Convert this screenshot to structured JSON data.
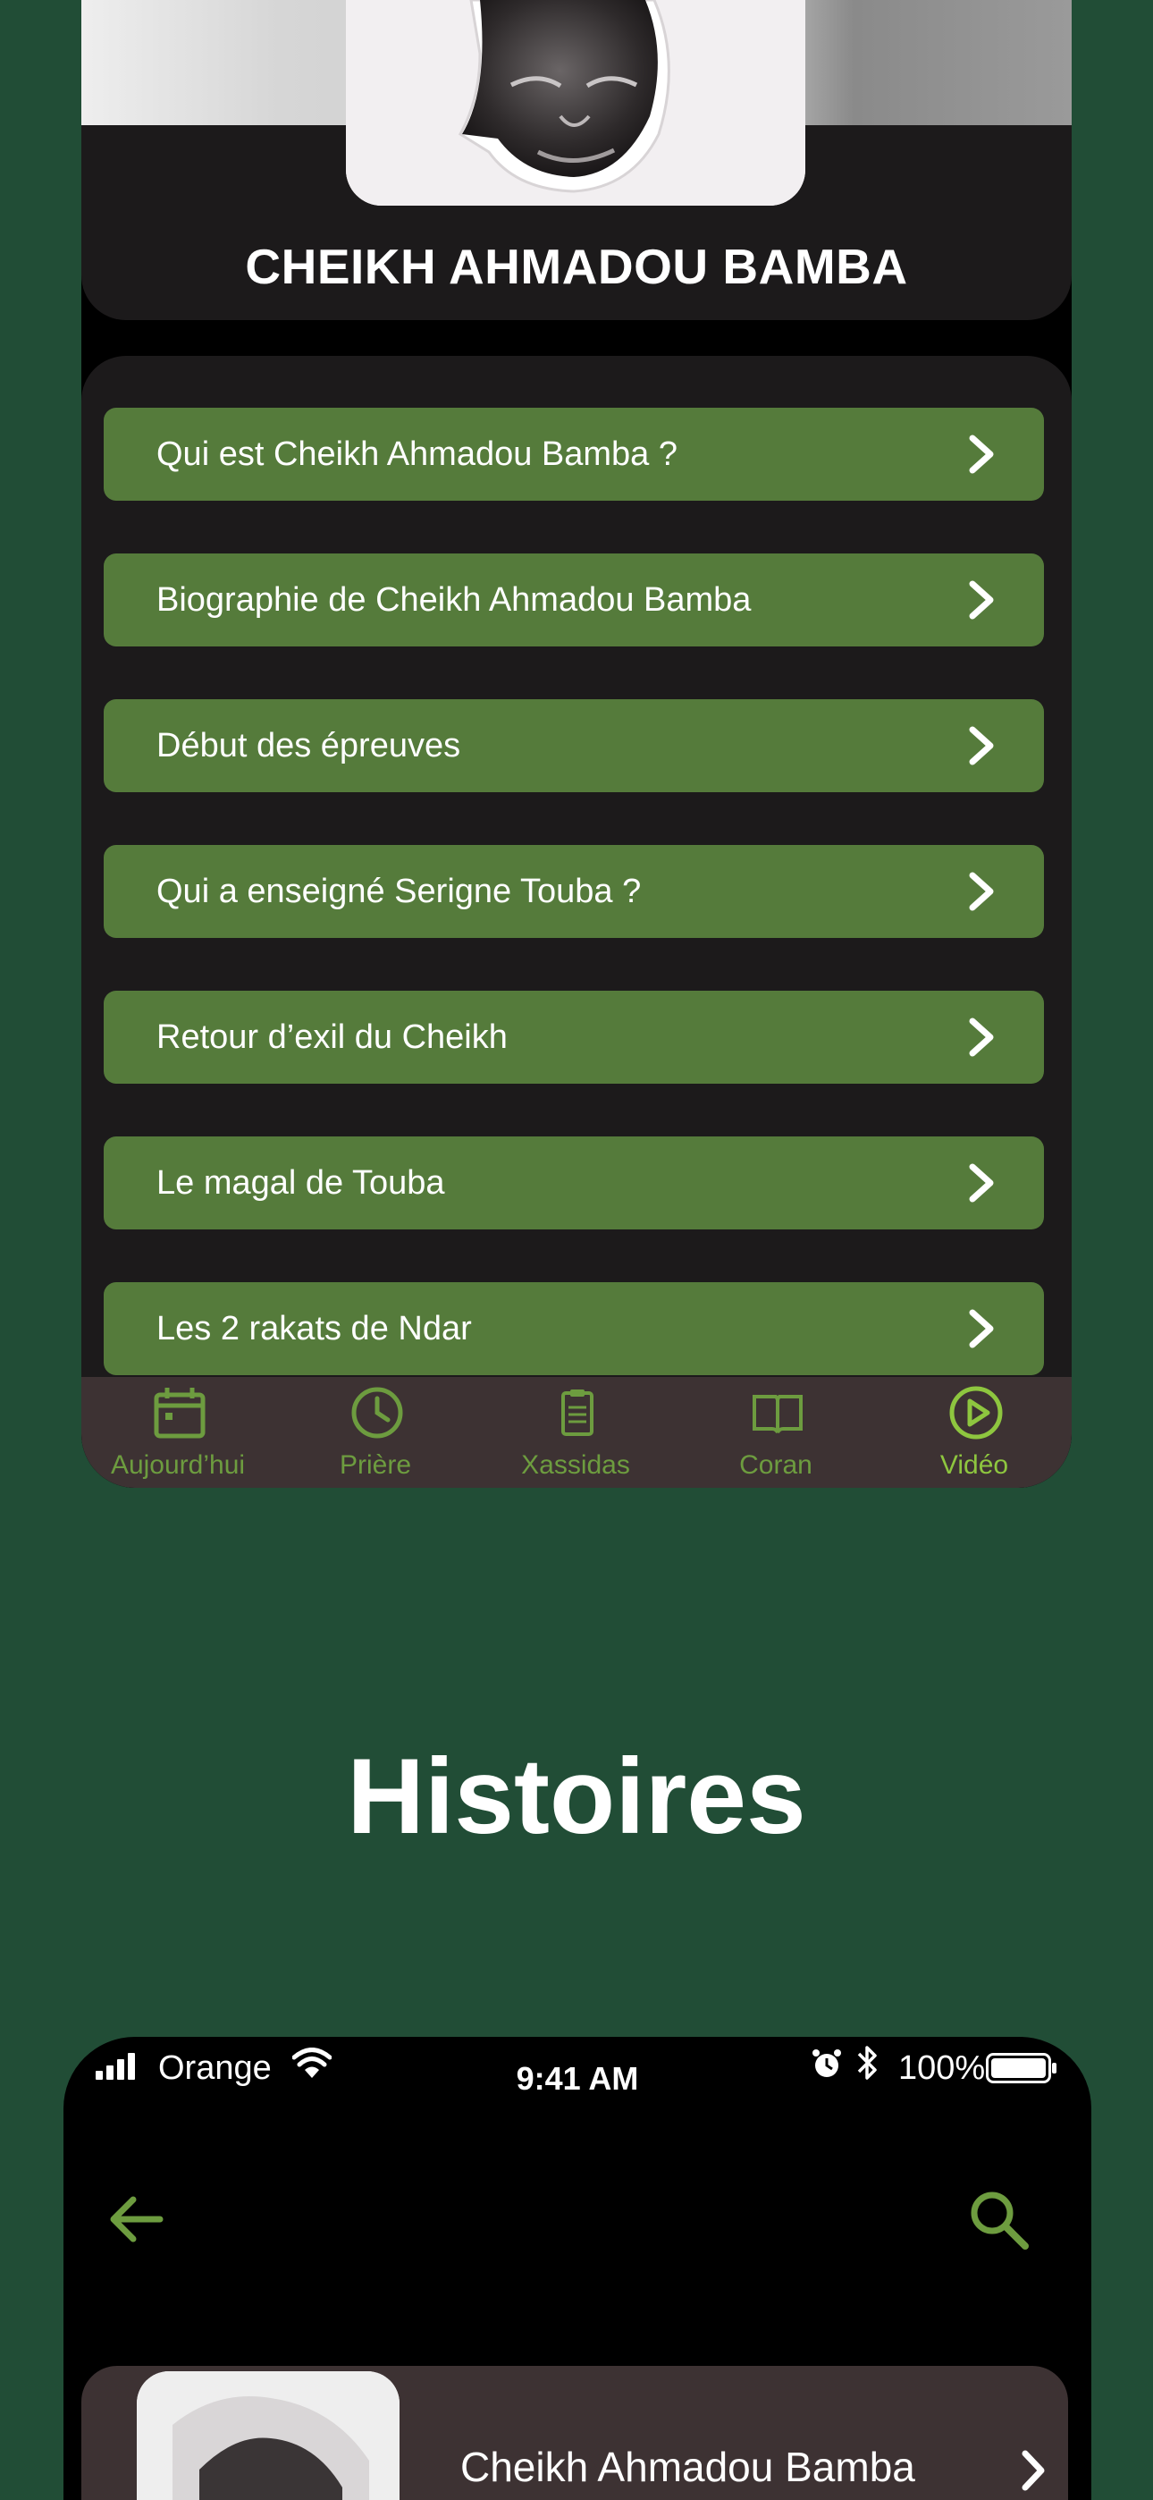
{
  "header": {
    "title": "CHEIKH AHMADOU BAMBA"
  },
  "stories": [
    {
      "label": "Qui est Cheikh Ahmadou Bamba ?"
    },
    {
      "label": "Biographie de Cheikh Ahmadou Bamba"
    },
    {
      "label": "Début des épreuves"
    },
    {
      "label": "Qui a enseigné Serigne Touba ?"
    },
    {
      "label": "Retour d’exil du Cheikh"
    },
    {
      "label": "Le magal de Touba"
    },
    {
      "label": "Les 2 rakats de Ndar"
    }
  ],
  "tabs": [
    {
      "label": "Aujourd’hui",
      "icon": "calendar-icon"
    },
    {
      "label": "Prière",
      "icon": "clock-icon"
    },
    {
      "label": "Xassidas",
      "icon": "clipboard-icon"
    },
    {
      "label": "Coran",
      "icon": "book-icon"
    },
    {
      "label": "Vidéo",
      "icon": "play-circle-icon"
    }
  ],
  "section_heading": "Histoires",
  "status_bar": {
    "carrier": "Orange",
    "time": "9:41 AM",
    "battery": "100%"
  },
  "toolbar": {
    "back_icon": "arrow-left-icon",
    "search_icon": "search-icon"
  },
  "card": {
    "title": "Cheikh Ahmadou Bamba"
  },
  "colors": {
    "background": "#214d36",
    "accent": "#557b3b",
    "icon_green": "#6d9c3f",
    "panel": "#1c1a1b",
    "tabbar": "#3d3233"
  }
}
